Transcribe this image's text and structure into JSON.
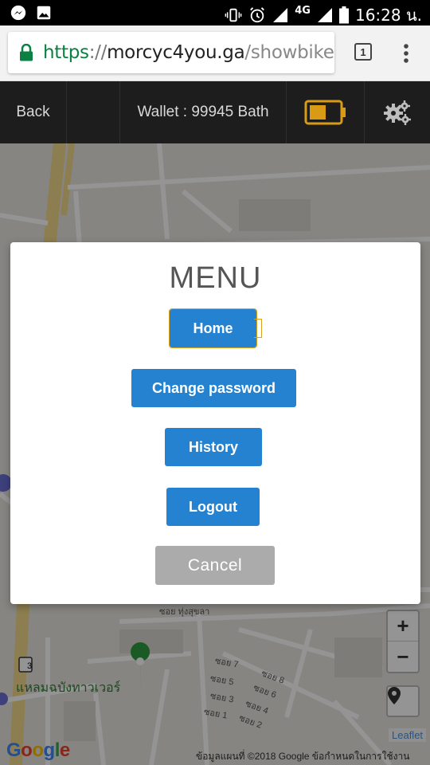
{
  "status_bar": {
    "time": "16:28 น.",
    "network": "4G"
  },
  "browser": {
    "url_scheme": "https",
    "url_sep": "://",
    "url_host": "morcyc4you.ga",
    "url_path": "/showbike",
    "tab_count": "1"
  },
  "nav": {
    "back_label": "Back",
    "wallet_label": "Wallet : 99945 Bath"
  },
  "map": {
    "place_name": "แหลมฉบังทาวเวอร์",
    "road_soi_tungsukla": "ซอย ทุ่งสุขลา",
    "road_soi_7": "ซอย 7",
    "road_soi_8": "ซอย 8",
    "road_soi_5": "ซอย 5",
    "road_soi_6": "ซอย 6",
    "road_soi_3": "ซอย 3",
    "road_soi_4": "ซอย 4",
    "road_soi_1": "ซอย 1",
    "road_soi_2": "ซอย 2",
    "zoom_in": "+",
    "zoom_out": "−",
    "leaflet": "Leaflet",
    "copyright": "ข้อมูลแผนที่ ©2018 Google   ข้อกำหนดในการใช้งาน",
    "route_number": "3"
  },
  "modal": {
    "title": "MENU",
    "home_label": "Home",
    "change_password_label": "Change password",
    "history_label": "History",
    "logout_label": "Logout",
    "cancel_label": "Cancel"
  },
  "colors": {
    "primary_button": "#2582d1",
    "cancel_button": "#ababab",
    "focus_outline": "#d9a21b",
    "battery": "#d99a16",
    "nav_background": "#1d1d1d"
  }
}
